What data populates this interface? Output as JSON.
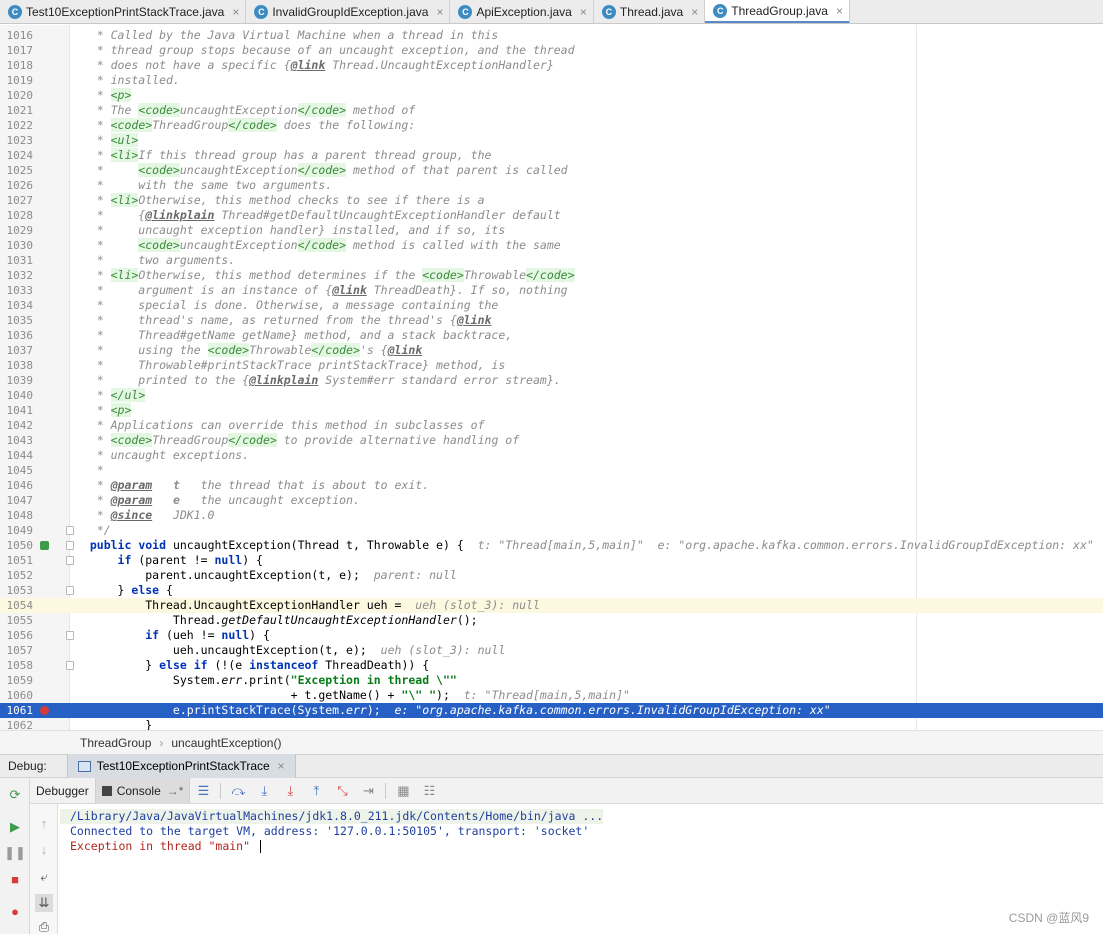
{
  "tabs": [
    {
      "label": "Test10ExceptionPrintStackTrace.java",
      "icon": "class-run-icon",
      "active": false
    },
    {
      "label": "InvalidGroupIdException.java",
      "icon": "exception-class-icon",
      "active": false
    },
    {
      "label": "ApiException.java",
      "icon": "exception-class-icon",
      "active": false
    },
    {
      "label": "Thread.java",
      "icon": "class-icon",
      "active": false
    },
    {
      "label": "ThreadGroup.java",
      "icon": "class-icon",
      "active": true
    }
  ],
  "editor": {
    "lines": [
      {
        "num": "1016",
        "html": "<span class=\"cm\">   * Called by the Java Virtual Machine when a thread in this</span>"
      },
      {
        "num": "1017",
        "html": "<span class=\"cm\">   * thread group stops because of an uncaught exception, and the thread</span>"
      },
      {
        "num": "1018",
        "html": "<span class=\"cm\">   * does not have a specific {<span class=\"jtag\">@link</span> Thread.UncaughtExceptionHandler}</span>"
      },
      {
        "num": "1019",
        "html": "<span class=\"cm\">   * installed.</span>"
      },
      {
        "num": "1020",
        "html": "<span class=\"cm\">   * <span class=\"tag\">&lt;p&gt;</span></span>"
      },
      {
        "num": "1021",
        "html": "<span class=\"cm\">   * The <span class=\"tag\">&lt;code&gt;</span>uncaughtException<span class=\"tag\">&lt;/code&gt;</span> method of</span>"
      },
      {
        "num": "1022",
        "html": "<span class=\"cm\">   * <span class=\"tag\">&lt;code&gt;</span>ThreadGroup<span class=\"tag\">&lt;/code&gt;</span> does the following:</span>"
      },
      {
        "num": "1023",
        "html": "<span class=\"cm\">   * <span class=\"tag\">&lt;ul&gt;</span></span>"
      },
      {
        "num": "1024",
        "html": "<span class=\"cm\">   * <span class=\"tag\">&lt;li&gt;</span>If this thread group has a parent thread group, the</span>"
      },
      {
        "num": "1025",
        "html": "<span class=\"cm\">   *     <span class=\"tag\">&lt;code&gt;</span>uncaughtException<span class=\"tag\">&lt;/code&gt;</span> method of that parent is called</span>"
      },
      {
        "num": "1026",
        "html": "<span class=\"cm\">   *     with the same two arguments.</span>"
      },
      {
        "num": "1027",
        "html": "<span class=\"cm\">   * <span class=\"tag\">&lt;li&gt;</span>Otherwise, this method checks to see if there is a</span>"
      },
      {
        "num": "1028",
        "html": "<span class=\"cm\">   *     {<span class=\"jtag\">@linkplain</span> Thread#getDefaultUncaughtExceptionHandler default</span>"
      },
      {
        "num": "1029",
        "html": "<span class=\"cm\">   *     uncaught exception handler} installed, and if so, its</span>"
      },
      {
        "num": "1030",
        "html": "<span class=\"cm\">   *     <span class=\"tag\">&lt;code&gt;</span>uncaughtException<span class=\"tag\">&lt;/code&gt;</span> method is called with the same</span>"
      },
      {
        "num": "1031",
        "html": "<span class=\"cm\">   *     two arguments.</span>"
      },
      {
        "num": "1032",
        "html": "<span class=\"cm\">   * <span class=\"tag\">&lt;li&gt;</span>Otherwise, this method determines if the <span class=\"tag\">&lt;code&gt;</span>Throwable<span class=\"tag\">&lt;/code&gt;</span></span>"
      },
      {
        "num": "1033",
        "html": "<span class=\"cm\">   *     argument is an instance of {<span class=\"jtag\">@link</span> ThreadDeath}. If so, nothing</span>"
      },
      {
        "num": "1034",
        "html": "<span class=\"cm\">   *     special is done. Otherwise, a message containing the</span>"
      },
      {
        "num": "1035",
        "html": "<span class=\"cm\">   *     thread's name, as returned from the thread's {<span class=\"jtag\">@link</span></span>"
      },
      {
        "num": "1036",
        "html": "<span class=\"cm\">   *     Thread#getName getName} method, and a stack backtrace,</span>"
      },
      {
        "num": "1037",
        "html": "<span class=\"cm\">   *     using the <span class=\"tag\">&lt;code&gt;</span>Throwable<span class=\"tag\">&lt;/code&gt;</span>'s {<span class=\"jtag\">@link</span></span>"
      },
      {
        "num": "1038",
        "html": "<span class=\"cm\">   *     Throwable#printStackTrace printStackTrace} method, is</span>"
      },
      {
        "num": "1039",
        "html": "<span class=\"cm\">   *     printed to the {<span class=\"jtag\">@linkplain</span> System#err standard error stream}.</span>"
      },
      {
        "num": "1040",
        "html": "<span class=\"cm\">   * <span class=\"tag\">&lt;/ul&gt;</span></span>"
      },
      {
        "num": "1041",
        "html": "<span class=\"cm\">   * <span class=\"tag\">&lt;p&gt;</span></span>"
      },
      {
        "num": "1042",
        "html": "<span class=\"cm\">   * Applications can override this method in subclasses of</span>"
      },
      {
        "num": "1043",
        "html": "<span class=\"cm\">   * <span class=\"tag\">&lt;code&gt;</span>ThreadGroup<span class=\"tag\">&lt;/code&gt;</span> to provide alternative handling of</span>"
      },
      {
        "num": "1044",
        "html": "<span class=\"cm\">   * uncaught exceptions.</span>"
      },
      {
        "num": "1045",
        "html": "<span class=\"cm\">   *</span>"
      },
      {
        "num": "1046",
        "html": "<span class=\"cm\">   * <span class=\"jtag\">@param</span>   <b>t</b>   the thread that is about to exit.</span>"
      },
      {
        "num": "1047",
        "html": "<span class=\"cm\">   * <span class=\"jtag\">@param</span>   <b>e</b>   the uncaught exception.</span>"
      },
      {
        "num": "1048",
        "html": "<span class=\"cm\">   * <span class=\"jtag\">@since</span>   JDK1.0</span>"
      },
      {
        "num": "1049",
        "html": "<span class=\"cm\">   */</span>",
        "fold": true
      },
      {
        "num": "1050",
        "html": "  <span class=\"kw\">public void</span> uncaughtException(Thread t, Throwable e) {  <span class=\"inl\">t: \"Thread[main,5,main]\"  e: \"org.apache.kafka.common.errors.InvalidGroupIdException: xx\"</span>",
        "mark": "over",
        "fold": true
      },
      {
        "num": "1051",
        "html": "      <span class=\"kw\">if</span> (parent != <span class=\"kw\">null</span>) {",
        "fold": true
      },
      {
        "num": "1052",
        "html": "          parent.uncaughtException(t, e);  <span class=\"inl\">parent: null</span>"
      },
      {
        "num": "1053",
        "html": "      } <span class=\"kw\">else</span> {",
        "fold": true
      },
      {
        "num": "1054",
        "html": "          Thread.UncaughtExceptionHandler ueh =  <span class=\"inl\">ueh (slot_3): null</span>",
        "caret": true
      },
      {
        "num": "1055",
        "html": "              Thread.<span class=\"ital\">getDefaultUncaughtExceptionHandler</span>();"
      },
      {
        "num": "1056",
        "html": "          <span class=\"kw\">if</span> (ueh != <span class=\"kw\">null</span>) {",
        "fold": true
      },
      {
        "num": "1057",
        "html": "              ueh.uncaughtException(t, e);  <span class=\"inl\">ueh (slot_3): null</span>"
      },
      {
        "num": "1058",
        "html": "          } <span class=\"kw\">else if</span> (!(e <span class=\"kw\">instanceof</span> ThreadDeath)) {",
        "fold": true
      },
      {
        "num": "1059",
        "html": "              System.<span class=\"ital\">err</span>.print(<span class=\"str\">\"Exception in thread \\\"\"</span>"
      },
      {
        "num": "1060",
        "html": "                               + t.getName() + <span class=\"str\">\"\\\" \"</span>);  <span class=\"inl\">t: \"Thread[main,5,main]\"</span>"
      },
      {
        "num": "1061",
        "html": "              e.printStackTrace(System.<span class=\"ital\">err</span>);  <span class=\"inl\">e: \"org.apache.kafka.common.errors.InvalidGroupIdException: xx\"</span>",
        "mark": "bp",
        "exec": true
      },
      {
        "num": "1062",
        "html": "          }"
      }
    ]
  },
  "breadcrumb": [
    "ThreadGroup",
    "uncaughtException()"
  ],
  "debug": {
    "label": "Debug:",
    "session_tab": "Test10ExceptionPrintStackTrace",
    "tool_tabs": [
      "Debugger",
      "Console"
    ],
    "console_lines": [
      {
        "text": "/Library/Java/JavaVirtualMachines/jdk1.8.0_211.jdk/Contents/Home/bin/java ...",
        "kind": "path"
      },
      {
        "text": "Connected to the target VM, address: '127.0.0.1:50105', transport: 'socket'",
        "kind": "info"
      },
      {
        "text": "Exception in thread \"main\" ",
        "kind": "err"
      }
    ]
  },
  "watermark": "CSDN @蓝风9",
  "colors": {
    "accent": "#2760c4",
    "keyword": "#0033b3",
    "string": "#067d17",
    "error": "#b3261e"
  }
}
